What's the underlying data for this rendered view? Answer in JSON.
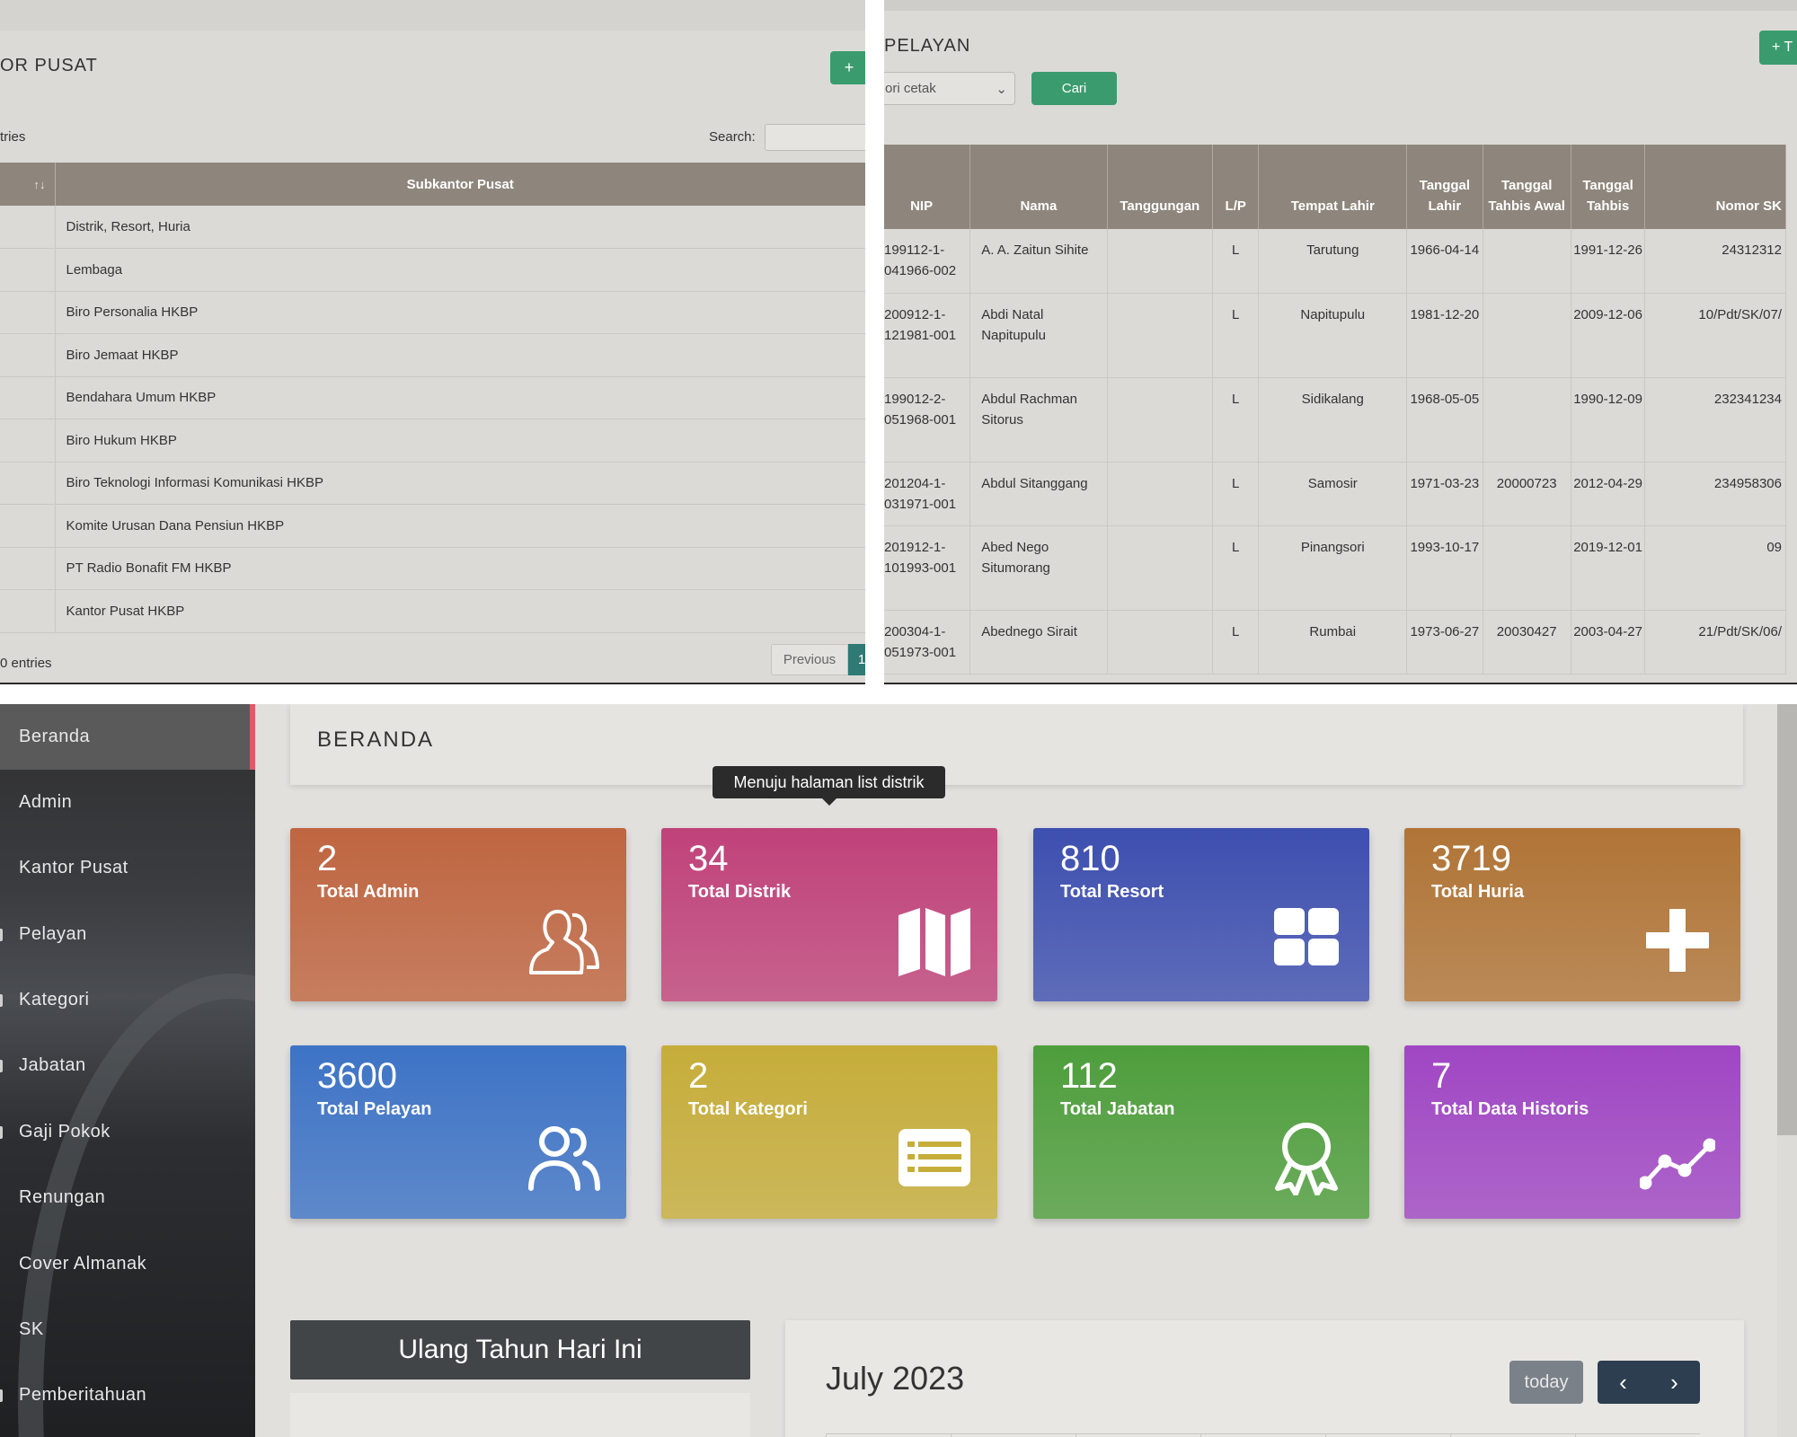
{
  "top_left": {
    "title": "OR PUSAT",
    "add_label": "+",
    "entries_label": "tries",
    "search_label": "Search:",
    "sort_glyph": "↑↓",
    "column_header": "Subkantor Pusat",
    "rows": [
      "Distrik, Resort, Huria",
      "Lembaga",
      "Biro Personalia HKBP",
      "Biro Jemaat HKBP",
      "Bendahara Umum HKBP",
      "Biro Hukum HKBP",
      "Biro Teknologi Informasi Komunikasi HKBP",
      "Komite Urusan Dana Pensiun HKBP",
      "PT Radio Bonafit FM HKBP",
      "Kantor Pusat HKBP"
    ],
    "footer": "0 entries",
    "previous_label": "Previous",
    "page_label": "1"
  },
  "top_right": {
    "title": "PELAYAN",
    "add_label": "+  T",
    "select_value": "ori cetak",
    "select_caret": "⌄",
    "search_button": "Cari",
    "headers": {
      "nip": "NIP",
      "nama": "Nama",
      "tanggungan": "Tanggungan",
      "lp": "L/P",
      "tempat_lahir": "Tempat Lahir",
      "tanggal_lahir": "Tanggal Lahir",
      "tahbis_awal": "Tanggal Tahbis Awal",
      "tanggal_tahbis": "Tanggal Tahbis",
      "nomor_sk": "Nomor SK"
    },
    "rows": [
      {
        "nip": "199112-1-041966-002",
        "nama": "A. A. Zaitun Sihite",
        "tanggungan": "",
        "lp": "L",
        "tempat": "Tarutung",
        "tgl_lahir": "1966-04-14",
        "awal": "",
        "tahbis": "1991-12-26",
        "sk": "24312312"
      },
      {
        "nip": "200912-1-121981-001",
        "nama": "Abdi Natal Napitupulu",
        "tanggungan": "",
        "lp": "L",
        "tempat": "Napitupulu",
        "tgl_lahir": "1981-12-20",
        "awal": "",
        "tahbis": "2009-12-06",
        "sk": "10/Pdt/SK/07/"
      },
      {
        "nip": "199012-2-051968-001",
        "nama": "Abdul Rachman Sitorus",
        "tanggungan": "",
        "lp": "L",
        "tempat": "Sidikalang",
        "tgl_lahir": "1968-05-05",
        "awal": "",
        "tahbis": "1990-12-09",
        "sk": "232341234"
      },
      {
        "nip": "201204-1-031971-001",
        "nama": "Abdul Sitanggang",
        "tanggungan": "",
        "lp": "L",
        "tempat": "Samosir",
        "tgl_lahir": "1971-03-23",
        "awal": "20000723",
        "tahbis": "2012-04-29",
        "sk": "234958306"
      },
      {
        "nip": "201912-1-101993-001",
        "nama": "Abed Nego Situmorang",
        "tanggungan": "",
        "lp": "L",
        "tempat": "Pinangsori",
        "tgl_lahir": "1993-10-17",
        "awal": "",
        "tahbis": "2019-12-01",
        "sk": "09"
      },
      {
        "nip": "200304-1-051973-001",
        "nama": "Abednego Sirait",
        "tanggungan": "",
        "lp": "L",
        "tempat": "Rumbai",
        "tgl_lahir": "1973-06-27",
        "awal": "20030427",
        "tahbis": "2003-04-27",
        "sk": "21/Pdt/SK/06/"
      }
    ]
  },
  "sidebar": {
    "items": [
      "Beranda",
      "Admin",
      "Kantor Pusat",
      "Pelayan",
      "Kategori",
      "Jabatan",
      "Gaji Pokok",
      "Renungan",
      "Cover Almanak",
      "SK",
      "Pemberitahuan"
    ]
  },
  "dashboard": {
    "title": "BERANDA",
    "tooltip": "Menuju halaman list distrik",
    "stats": [
      {
        "value": "2",
        "label": "Total Admin",
        "icon": "user-outline-icon",
        "color": "#bf6540"
      },
      {
        "value": "34",
        "label": "Total Distrik",
        "icon": "map-icon",
        "color": "#c0427a"
      },
      {
        "value": "810",
        "label": "Total Resort",
        "icon": "grid-icon",
        "color": "#3d4fb0"
      },
      {
        "value": "3719",
        "label": "Total Huria",
        "icon": "plus-icon",
        "color": "#b07436"
      },
      {
        "value": "3600",
        "label": "Total Pelayan",
        "icon": "users-icon",
        "color": "#3d73c6"
      },
      {
        "value": "2",
        "label": "Total Kategori",
        "icon": "list-card-icon",
        "color": "#c6ad3a"
      },
      {
        "value": "112",
        "label": "Total Jabatan",
        "icon": "award-icon",
        "color": "#4e9e3c"
      },
      {
        "value": "7",
        "label": "Total Data Historis",
        "icon": "chart-line-icon",
        "color": "#a046c4"
      }
    ],
    "birthday_title": "Ulang Tahun Hari Ini",
    "calendar_title": "July 2023",
    "today_label": "today",
    "prev_glyph": "‹",
    "next_glyph": "›"
  }
}
